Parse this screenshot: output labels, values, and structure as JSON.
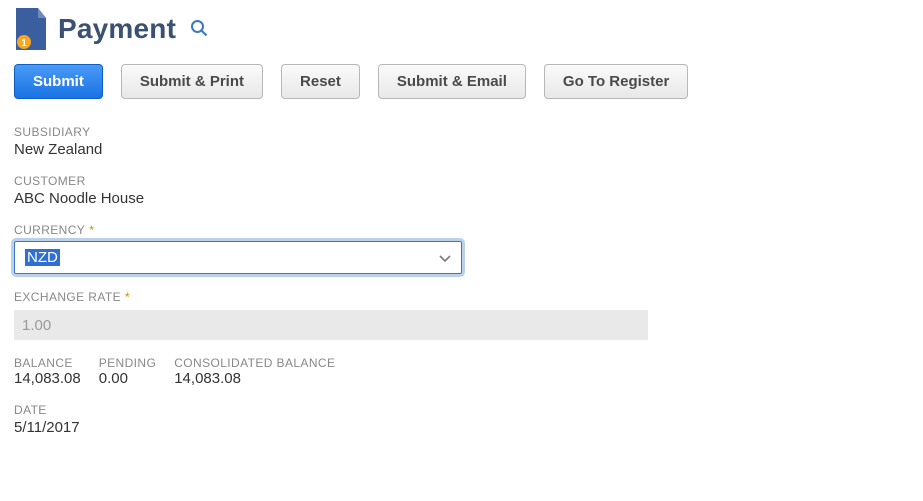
{
  "header": {
    "title": "Payment"
  },
  "toolbar": {
    "submit": "Submit",
    "submitPrint": "Submit & Print",
    "reset": "Reset",
    "submitEmail": "Submit & Email",
    "goToRegister": "Go To Register"
  },
  "fields": {
    "subsidiary": {
      "label": "SUBSIDIARY",
      "value": "New Zealand"
    },
    "customer": {
      "label": "CUSTOMER",
      "value": "ABC Noodle House"
    },
    "currency": {
      "label": "CURRENCY",
      "value": "NZD"
    },
    "exchangeRate": {
      "label": "EXCHANGE RATE",
      "value": "1.00"
    },
    "balance": {
      "label": "BALANCE",
      "value": "14,083.08"
    },
    "pending": {
      "label": "PENDING",
      "value": "0.00"
    },
    "consolidated": {
      "label": "CONSOLIDATED BALANCE",
      "value": "14,083.08"
    },
    "date": {
      "label": "DATE",
      "value": "5/11/2017"
    }
  }
}
